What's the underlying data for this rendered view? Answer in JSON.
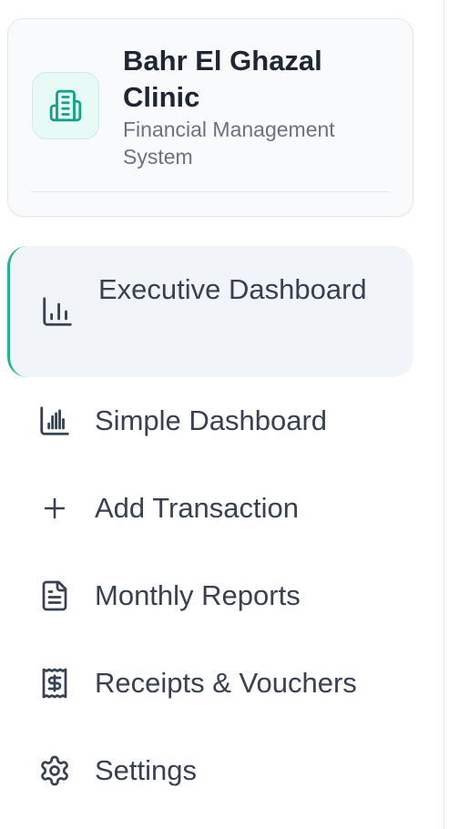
{
  "brand": {
    "title": "Bahr El Ghazal Clinic",
    "subtitle": "Financial Management System",
    "logo_icon": "building-icon",
    "accent_color": "#1fb394"
  },
  "nav": {
    "items": [
      {
        "label": "Executive Dashboard",
        "icon": "bar-chart-icon",
        "active": true
      },
      {
        "label": "Simple Dashboard",
        "icon": "bar-chart-icon",
        "active": false
      },
      {
        "label": "Add Transaction",
        "icon": "plus-icon",
        "active": false
      },
      {
        "label": "Monthly Reports",
        "icon": "file-text-icon",
        "active": false
      },
      {
        "label": "Receipts & Vouchers",
        "icon": "receipt-icon",
        "active": false
      },
      {
        "label": "Settings",
        "icon": "gear-icon",
        "active": false
      }
    ]
  }
}
